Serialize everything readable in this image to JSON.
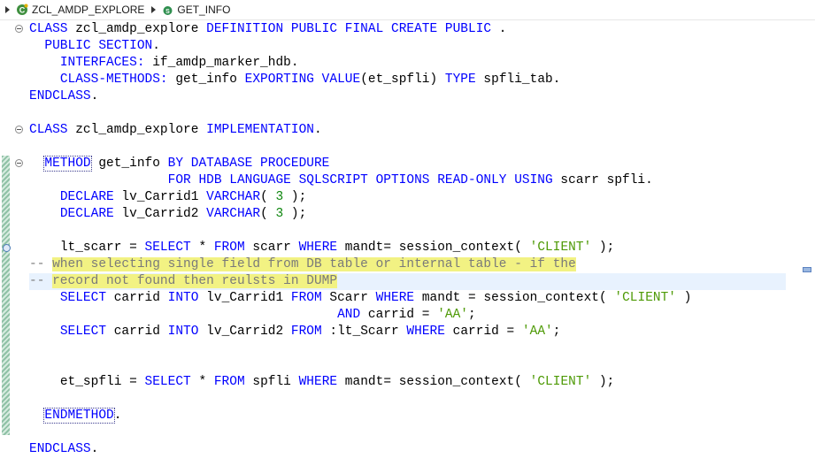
{
  "breadcrumb": {
    "class_name": "ZCL_AMDP_EXPLORE",
    "method_name": "GET_INFO"
  },
  "icons": {
    "class": "class-icon",
    "method": "method-icon",
    "fold": "fold-toggle-icon"
  },
  "colors": {
    "keyword": "#0000ff",
    "string": "#4e9a06",
    "comment": "#7a7a7a",
    "highlight": "#f2f283",
    "current_line": "#e8f2fe",
    "change_bar": "#8fc1a6"
  },
  "code": {
    "l1": {
      "kw1": "CLASS",
      "t1": " zcl_amdp_explore ",
      "kw2": "DEFINITION PUBLIC FINAL CREATE PUBLIC",
      "t2": " ."
    },
    "l2": {
      "kw1": "PUBLIC SECTION",
      "t1": "."
    },
    "l3": {
      "kw1": "INTERFACES:",
      "t1": " if_amdp_marker_hdb."
    },
    "l4": {
      "kw1": "CLASS-METHODS:",
      "t1": " get_info ",
      "kw2": "EXPORTING VALUE",
      "t2": "(et_spfli) ",
      "kw3": "TYPE",
      "t3": " spfli_tab."
    },
    "l5": {
      "kw1": "ENDCLASS",
      "t1": "."
    },
    "l6": {
      "kw1": "CLASS",
      "t1": " zcl_amdp_explore ",
      "kw2": "IMPLEMENTATION",
      "t2": "."
    },
    "l7": {
      "kw1": "METHOD",
      "t1": " get_info ",
      "kw2": "BY DATABASE PROCEDURE"
    },
    "l8": {
      "kw1": "FOR HDB LANGUAGE SQLSCRIPT OPTIONS READ-ONLY USING",
      "t1": " scarr spfli."
    },
    "l9": {
      "kw1": "DECLARE",
      "t1": " lv_Carrid1 ",
      "kw2": "VARCHAR",
      "t2": "( ",
      "n1": "3",
      "t3": " );"
    },
    "l10": {
      "kw1": "DECLARE",
      "t1": " lv_Carrid2 ",
      "kw2": "VARCHAR",
      "t2": "( ",
      "n1": "3",
      "t3": " );"
    },
    "l11": {
      "t1": "lt_scarr = ",
      "kw1": "SELECT",
      "t2": " * ",
      "kw2": "FROM",
      "t3": " scarr ",
      "kw3": "WHERE",
      "t4": " mandt= session_context( ",
      "s1": "'CLIENT'",
      "t5": " );"
    },
    "l12": {
      "c1": "-- ",
      "c2": "when selecting single field from DB table or internal table - if the"
    },
    "l13": {
      "c1": "-- ",
      "c2": "record not found then reulsts in DUMP"
    },
    "l14": {
      "kw1": "SELECT",
      "t1": " carrid ",
      "kw2": "INTO",
      "t2": " lv_Carrid1 ",
      "kw3": "FROM",
      "t3": " Scarr ",
      "kw4": "WHERE",
      "t4": " mandt = session_context( ",
      "s1": "'CLIENT'",
      "t5": " )"
    },
    "l15": {
      "kw1": "AND",
      "t1": " carrid = ",
      "s1": "'AA'",
      "t2": ";"
    },
    "l16": {
      "kw1": "SELECT",
      "t1": " carrid ",
      "kw2": "INTO",
      "t2": " lv_Carrid2 ",
      "kw3": "FROM",
      "t3": " :lt_Scarr ",
      "kw4": "WHERE",
      "t4": " carrid = ",
      "s1": "'AA'",
      "t5": ";"
    },
    "l17": {
      "t1": "et_spfli = ",
      "kw1": "SELECT",
      "t2": " * ",
      "kw2": "FROM",
      "t3": " spfli ",
      "kw3": "WHERE",
      "t4": " mandt= session_context( ",
      "s1": "'CLIENT'",
      "t5": " );"
    },
    "l18": {
      "kw1": "ENDMETHOD",
      "t1": "."
    },
    "l19": {
      "kw1": "ENDCLASS",
      "t1": "."
    }
  }
}
